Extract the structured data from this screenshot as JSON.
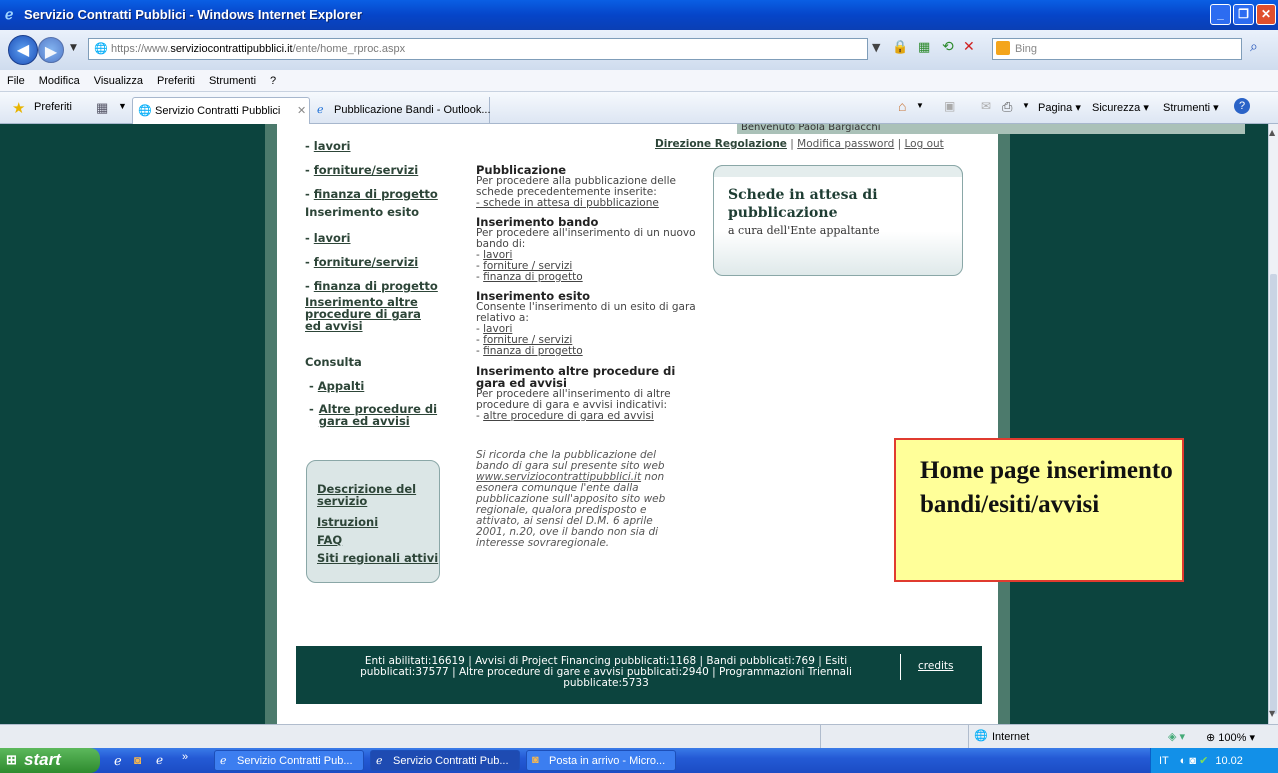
{
  "window": {
    "title": "Servizio Contratti Pubblici - Windows Internet Explorer"
  },
  "address": {
    "protocol": "https://",
    "domain_prefix": "www.",
    "domain": "serviziocontrattipubblici.it",
    "path": "/ente/home_rproc.aspx"
  },
  "search": {
    "placeholder": "Bing"
  },
  "menu": [
    "File",
    "Modifica",
    "Visualizza",
    "Preferiti",
    "Strumenti",
    "?"
  ],
  "favorites": {
    "label": "Preferiti"
  },
  "tabs": [
    {
      "label": "Servizio Contratti Pubblici"
    },
    {
      "label": "Pubblicazione Bandi - Outlook..."
    }
  ],
  "toolbar": {
    "pagina": "Pagina",
    "sicurezza": "Sicurezza",
    "strumenti": "Strumenti"
  },
  "page": {
    "welcome": "Benvenuto Paola Bargiacchi",
    "toplinks": {
      "direzione": "Direzione Regolazione",
      "sep1": "|",
      "modifica": "Modifica password",
      "sep2": "|",
      "logout": "Log out"
    },
    "left": {
      "top_items": [
        "lavori",
        "forniture/servizi",
        "finanza di progetto"
      ],
      "esito_title": "Inserimento esito",
      "esito_items": [
        "lavori",
        "forniture/servizi",
        "finanza di progetto"
      ],
      "altre_title": "Inserimento altre procedure di gara ed avvisi",
      "consulta_title": "Consulta",
      "consulta_items": [
        "Appalti",
        "Altre procedure di gara ed avvisi"
      ],
      "box_links": [
        "Descrizione del servizio",
        "Istruzioni",
        "FAQ",
        "Siti regionali attivi"
      ]
    },
    "middle": {
      "pub_title": "Pubblicazione",
      "pub_text": "Per procedere alla pubblicazione delle schede precedentemente inserite:",
      "pub_link": "- schede in attesa di pubblicazione",
      "bando_title": "Inserimento bando",
      "bando_text": "Per procedere all'inserimento di un nuovo bando di:",
      "bando_links": [
        "lavori",
        "forniture / servizi",
        "finanza di progetto"
      ],
      "esito_title": "Inserimento esito",
      "esito_text": "Consente l'inserimento di un esito di gara relativo a:",
      "esito_links": [
        "lavori",
        "forniture / servizi",
        "finanza di progetto"
      ],
      "altre_title": "Inserimento altre procedure di gara ed avvisi",
      "altre_text": "Per procedere all'inserimento di altre procedure di gara e avvisi indicativi:",
      "altre_link": "altre procedure di gara ed avvisi",
      "note_pre": "Si ricorda che la pubblicazione del bando di gara sul presente sito web",
      "note_link": "www.serviziocontrattipubblici.it",
      "note_post": "non esonera comunque l'ente dalla pubblicazione sull'apposito sito web regionale, qualora predisposto e attivato, ai sensi del D.M. 6 aprile 2001, n.20, ove il bando non sia di interesse sovraregionale."
    },
    "notebox": {
      "title": "Schede in attesa di pubblicazione",
      "subtitle": "a cura dell'Ente appaltante"
    },
    "footer": {
      "stats": "Enti abilitati:16619 | Avvisi di Project Financing pubblicati:1168 | Bandi pubblicati:769 | Esiti pubblicati:37577 | Altre procedure di gare e avvisi pubblicati:2940 | Programmazioni Triennali pubblicate:5733",
      "credits": "credits"
    }
  },
  "callout": {
    "text": "Home page inserimento bandi/esiti/avvisi"
  },
  "status": {
    "zone": "Internet",
    "zoom": "100%"
  },
  "taskbar": {
    "start": "start",
    "tasks": [
      "Servizio Contratti Pub...",
      "Servizio Contratti Pub...",
      "Posta in arrivo - Micro..."
    ],
    "lang": "IT",
    "clock": "10.02"
  },
  "colors": {
    "page_bg": "#0c443e",
    "title_bar": "#0645c9",
    "callout_border": "#e03b2f",
    "callout_bg": "#ffff99"
  }
}
